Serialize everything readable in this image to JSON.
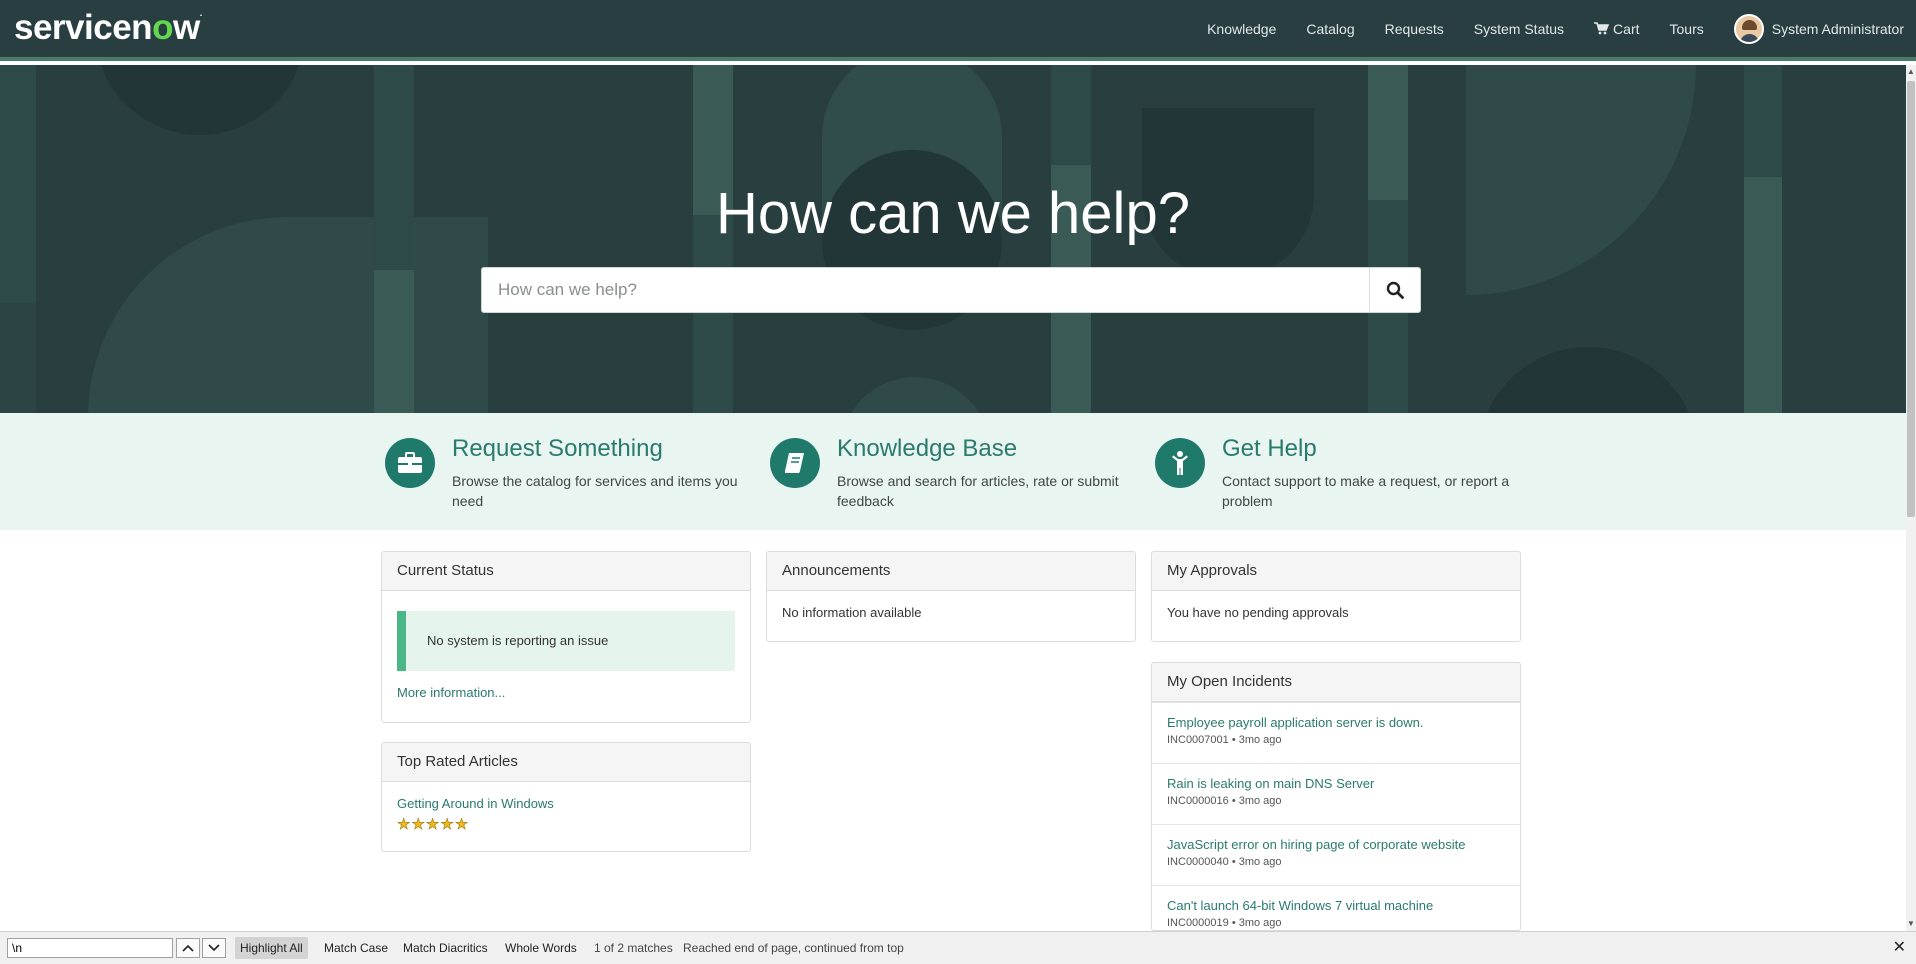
{
  "header": {
    "logo": {
      "part1": "servicen",
      "o": "o",
      "part2": "w",
      "tm": "."
    },
    "nav": {
      "knowledge": "Knowledge",
      "catalog": "Catalog",
      "requests": "Requests",
      "system_status": "System Status",
      "cart": "Cart",
      "tours": "Tours",
      "user": "System Administrator"
    }
  },
  "hero": {
    "title": "How can we help?",
    "search_placeholder": "How can we help?"
  },
  "quick_links": [
    {
      "title": "Request Something",
      "desc": "Browse the catalog for services and items you need",
      "icon": "briefcase-icon"
    },
    {
      "title": "Knowledge Base",
      "desc": "Browse and search for articles, rate or submit feedback",
      "icon": "book-icon"
    },
    {
      "title": "Get Help",
      "desc": "Contact support to make a request, or report a problem",
      "icon": "person-icon"
    }
  ],
  "current_status": {
    "title": "Current Status",
    "message": "No system is reporting an issue",
    "more": "More information..."
  },
  "top_rated": {
    "title": "Top Rated Articles",
    "article": "Getting Around in Windows",
    "rating": 5
  },
  "announcements": {
    "title": "Announcements",
    "message": "No information available"
  },
  "approvals": {
    "title": "My Approvals",
    "message": "You have no pending approvals"
  },
  "incidents": {
    "title": "My Open Incidents",
    "items": [
      {
        "title": "Employee payroll application server is down.",
        "meta": "INC0007001 • 3mo ago"
      },
      {
        "title": "Rain is leaking on main DNS Server",
        "meta": "INC0000016 • 3mo ago"
      },
      {
        "title": "JavaScript error on hiring page of corporate website",
        "meta": "INC0000040 • 3mo ago"
      },
      {
        "title": "Can't launch 64-bit Windows 7 virtual machine",
        "meta": "INC0000019 • 3mo ago"
      }
    ]
  },
  "findbar": {
    "query": "\\n",
    "highlight_all": "Highlight All",
    "match_case": "Match Case",
    "match_diacritics": "Match Diacritics",
    "whole_words": "Whole Words",
    "count": "1 of 2 matches",
    "status": "Reached end of page, continued from top"
  },
  "colors": {
    "header_bg": "#293e40",
    "accent": "#2b7a6f",
    "quick_bg": "#e8f5f1",
    "status_ok": "#4bb786"
  }
}
